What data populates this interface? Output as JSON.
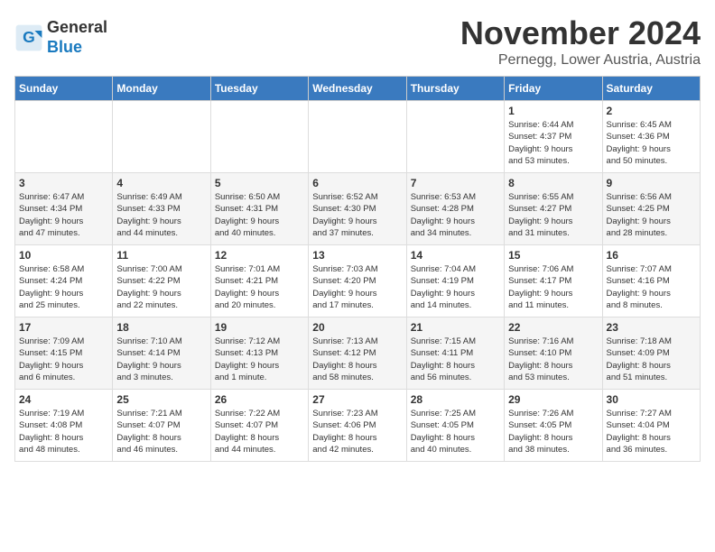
{
  "header": {
    "logo_line1": "General",
    "logo_line2": "Blue",
    "month": "November 2024",
    "location": "Pernegg, Lower Austria, Austria"
  },
  "weekdays": [
    "Sunday",
    "Monday",
    "Tuesday",
    "Wednesday",
    "Thursday",
    "Friday",
    "Saturday"
  ],
  "weeks": [
    [
      {
        "day": "",
        "info": ""
      },
      {
        "day": "",
        "info": ""
      },
      {
        "day": "",
        "info": ""
      },
      {
        "day": "",
        "info": ""
      },
      {
        "day": "",
        "info": ""
      },
      {
        "day": "1",
        "info": "Sunrise: 6:44 AM\nSunset: 4:37 PM\nDaylight: 9 hours\nand 53 minutes."
      },
      {
        "day": "2",
        "info": "Sunrise: 6:45 AM\nSunset: 4:36 PM\nDaylight: 9 hours\nand 50 minutes."
      }
    ],
    [
      {
        "day": "3",
        "info": "Sunrise: 6:47 AM\nSunset: 4:34 PM\nDaylight: 9 hours\nand 47 minutes."
      },
      {
        "day": "4",
        "info": "Sunrise: 6:49 AM\nSunset: 4:33 PM\nDaylight: 9 hours\nand 44 minutes."
      },
      {
        "day": "5",
        "info": "Sunrise: 6:50 AM\nSunset: 4:31 PM\nDaylight: 9 hours\nand 40 minutes."
      },
      {
        "day": "6",
        "info": "Sunrise: 6:52 AM\nSunset: 4:30 PM\nDaylight: 9 hours\nand 37 minutes."
      },
      {
        "day": "7",
        "info": "Sunrise: 6:53 AM\nSunset: 4:28 PM\nDaylight: 9 hours\nand 34 minutes."
      },
      {
        "day": "8",
        "info": "Sunrise: 6:55 AM\nSunset: 4:27 PM\nDaylight: 9 hours\nand 31 minutes."
      },
      {
        "day": "9",
        "info": "Sunrise: 6:56 AM\nSunset: 4:25 PM\nDaylight: 9 hours\nand 28 minutes."
      }
    ],
    [
      {
        "day": "10",
        "info": "Sunrise: 6:58 AM\nSunset: 4:24 PM\nDaylight: 9 hours\nand 25 minutes."
      },
      {
        "day": "11",
        "info": "Sunrise: 7:00 AM\nSunset: 4:22 PM\nDaylight: 9 hours\nand 22 minutes."
      },
      {
        "day": "12",
        "info": "Sunrise: 7:01 AM\nSunset: 4:21 PM\nDaylight: 9 hours\nand 20 minutes."
      },
      {
        "day": "13",
        "info": "Sunrise: 7:03 AM\nSunset: 4:20 PM\nDaylight: 9 hours\nand 17 minutes."
      },
      {
        "day": "14",
        "info": "Sunrise: 7:04 AM\nSunset: 4:19 PM\nDaylight: 9 hours\nand 14 minutes."
      },
      {
        "day": "15",
        "info": "Sunrise: 7:06 AM\nSunset: 4:17 PM\nDaylight: 9 hours\nand 11 minutes."
      },
      {
        "day": "16",
        "info": "Sunrise: 7:07 AM\nSunset: 4:16 PM\nDaylight: 9 hours\nand 8 minutes."
      }
    ],
    [
      {
        "day": "17",
        "info": "Sunrise: 7:09 AM\nSunset: 4:15 PM\nDaylight: 9 hours\nand 6 minutes."
      },
      {
        "day": "18",
        "info": "Sunrise: 7:10 AM\nSunset: 4:14 PM\nDaylight: 9 hours\nand 3 minutes."
      },
      {
        "day": "19",
        "info": "Sunrise: 7:12 AM\nSunset: 4:13 PM\nDaylight: 9 hours\nand 1 minute."
      },
      {
        "day": "20",
        "info": "Sunrise: 7:13 AM\nSunset: 4:12 PM\nDaylight: 8 hours\nand 58 minutes."
      },
      {
        "day": "21",
        "info": "Sunrise: 7:15 AM\nSunset: 4:11 PM\nDaylight: 8 hours\nand 56 minutes."
      },
      {
        "day": "22",
        "info": "Sunrise: 7:16 AM\nSunset: 4:10 PM\nDaylight: 8 hours\nand 53 minutes."
      },
      {
        "day": "23",
        "info": "Sunrise: 7:18 AM\nSunset: 4:09 PM\nDaylight: 8 hours\nand 51 minutes."
      }
    ],
    [
      {
        "day": "24",
        "info": "Sunrise: 7:19 AM\nSunset: 4:08 PM\nDaylight: 8 hours\nand 48 minutes."
      },
      {
        "day": "25",
        "info": "Sunrise: 7:21 AM\nSunset: 4:07 PM\nDaylight: 8 hours\nand 46 minutes."
      },
      {
        "day": "26",
        "info": "Sunrise: 7:22 AM\nSunset: 4:07 PM\nDaylight: 8 hours\nand 44 minutes."
      },
      {
        "day": "27",
        "info": "Sunrise: 7:23 AM\nSunset: 4:06 PM\nDaylight: 8 hours\nand 42 minutes."
      },
      {
        "day": "28",
        "info": "Sunrise: 7:25 AM\nSunset: 4:05 PM\nDaylight: 8 hours\nand 40 minutes."
      },
      {
        "day": "29",
        "info": "Sunrise: 7:26 AM\nSunset: 4:05 PM\nDaylight: 8 hours\nand 38 minutes."
      },
      {
        "day": "30",
        "info": "Sunrise: 7:27 AM\nSunset: 4:04 PM\nDaylight: 8 hours\nand 36 minutes."
      }
    ]
  ]
}
